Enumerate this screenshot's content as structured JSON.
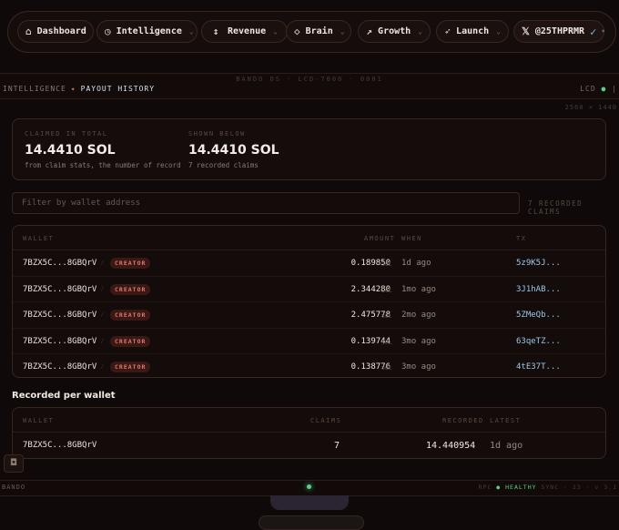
{
  "nav": {
    "items": [
      {
        "label": "Dashboard",
        "icon": "home-icon",
        "glyph": "⌂"
      },
      {
        "label": "Intelligence",
        "icon": "clock-icon",
        "glyph": "◷"
      },
      {
        "label": "Revenue",
        "icon": "updown-arrows-icon",
        "glyph": "↕"
      },
      {
        "label": "Brain",
        "icon": "diamond-icon",
        "glyph": "◇"
      },
      {
        "label": "Growth",
        "icon": "trend-up-icon",
        "glyph": "↗"
      },
      {
        "label": "Launch",
        "icon": "rocket-icon",
        "glyph": "➶"
      }
    ],
    "user": {
      "label": "@25THPRMR",
      "x_glyph": "𝕏",
      "check": "✓",
      "chevron": "•"
    }
  },
  "header": {
    "system_title": "BANDO OS · LCD-7000 · 0001",
    "breadcrumb_parent": "INTELLIGENCE",
    "breadcrumb_sep": "✦",
    "breadcrumb_current": "PAYOUT HISTORY",
    "status": "LCD",
    "status_dot": "●",
    "status_tail": "|",
    "subtext": "2560 × 1440"
  },
  "summary": {
    "claimed_label": "CLAIMED IN TOTAL",
    "claimed_value": "14.4410 SOL",
    "claimed_note": "from claim stats, the number of record",
    "shown_label": "SHOWN BELOW",
    "shown_value": "14.4410 SOL",
    "shown_note": "7 recorded claims"
  },
  "filter": {
    "placeholder": "Filter by wallet address",
    "count": "7 RECORDED CLAIMS"
  },
  "claims_table": {
    "headers": {
      "wallet": "WALLET",
      "amount": "AMOUNT",
      "when": "WHEN",
      "tx": "TX"
    },
    "unit": "SOL",
    "rows": [
      {
        "wallet": "7BZX5C...8GBQrV",
        "tag": "CREATOR",
        "amount": "0.189850",
        "when": "1d ago",
        "tx": "5z9K5J..."
      },
      {
        "wallet": "7BZX5C...8GBQrV",
        "tag": "CREATOR",
        "amount": "2.344280",
        "when": "1mo ago",
        "tx": "3J1hAB..."
      },
      {
        "wallet": "7BZX5C...8GBQrV",
        "tag": "CREATOR",
        "amount": "2.475778",
        "when": "2mo ago",
        "tx": "5ZMeQb..."
      },
      {
        "wallet": "7BZX5C...8GBQrV",
        "tag": "CREATOR",
        "amount": "0.139744",
        "when": "3mo ago",
        "tx": "63qeTZ..."
      },
      {
        "wallet": "7BZX5C...8GBQrV",
        "tag": "CREATOR",
        "amount": "0.138776",
        "when": "3mo ago",
        "tx": "4tE37T..."
      }
    ]
  },
  "per_wallet": {
    "title": "Recorded per wallet",
    "headers": {
      "wallet": "WALLET",
      "claims": "CLAIMS",
      "recorded": "RECORDED",
      "latest": "LATEST"
    },
    "rows": [
      {
        "wallet": "7BZX5C...8GBQrV",
        "claims": "7",
        "recorded": "14.440954",
        "latest": "1d ago"
      }
    ]
  },
  "footer": {
    "left": "BANDO",
    "right_prefix": "RPC",
    "right_dot": "●",
    "right_status": "HEALTHY",
    "right_tail": "SYNC · 23 · v 3.1"
  },
  "camera_glyph": "◘"
}
